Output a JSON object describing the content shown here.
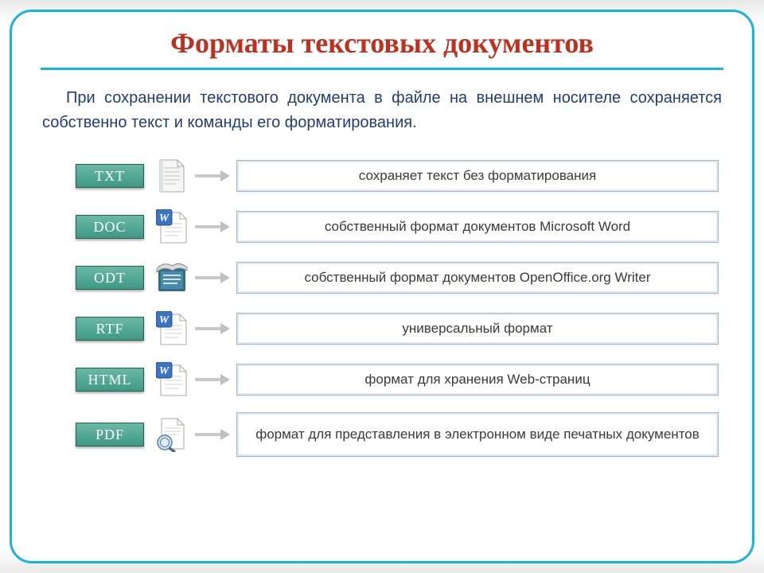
{
  "title": "Форматы текстовых документов",
  "intro": "При сохранении текстового документа в файле на внешнем носителе сохраняется собственно текст и команды его форматирования.",
  "rows": [
    {
      "label": "TXT",
      "desc": "сохраняет текст без форматирования",
      "tall": false
    },
    {
      "label": "DOC",
      "desc": "собственный формат документов Microsoft Word",
      "tall": false
    },
    {
      "label": "ODT",
      "desc": "собственный формат документов OpenOffice.org Writer",
      "tall": false
    },
    {
      "label": "RTF",
      "desc": "универсальный формат",
      "tall": false
    },
    {
      "label": "HTML",
      "desc": "формат для хранения Web-страниц",
      "tall": false
    },
    {
      "label": "PDF",
      "desc": "формат для представления в электронном виде печатных документов",
      "tall": true
    }
  ]
}
